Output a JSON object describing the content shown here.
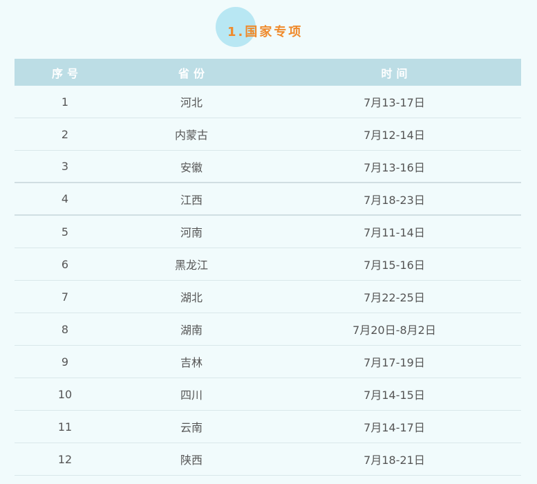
{
  "title": "1.国家专项",
  "table": {
    "headers": [
      "序号",
      "省份",
      "时间"
    ],
    "rows": [
      {
        "no": "1",
        "province": "河北",
        "time": "7月13-17日"
      },
      {
        "no": "2",
        "province": "内蒙古",
        "time": "7月12-14日"
      },
      {
        "no": "3",
        "province": "安徽",
        "time": "7月13-16日"
      },
      {
        "no": "4",
        "province": "江西",
        "time": "7月18-23日"
      },
      {
        "no": "5",
        "province": "河南",
        "time": "7月11-14日"
      },
      {
        "no": "6",
        "province": "黑龙江",
        "time": "7月15-16日"
      },
      {
        "no": "7",
        "province": "湖北",
        "time": "7月22-25日"
      },
      {
        "no": "8",
        "province": "湖南",
        "time": "7月20日-8月2日"
      },
      {
        "no": "9",
        "province": "吉林",
        "time": "7月17-19日"
      },
      {
        "no": "10",
        "province": "四川",
        "time": "7月14-15日"
      },
      {
        "no": "11",
        "province": "云南",
        "time": "7月14-17日"
      },
      {
        "no": "12",
        "province": "陕西",
        "time": "7月18-21日"
      }
    ]
  }
}
